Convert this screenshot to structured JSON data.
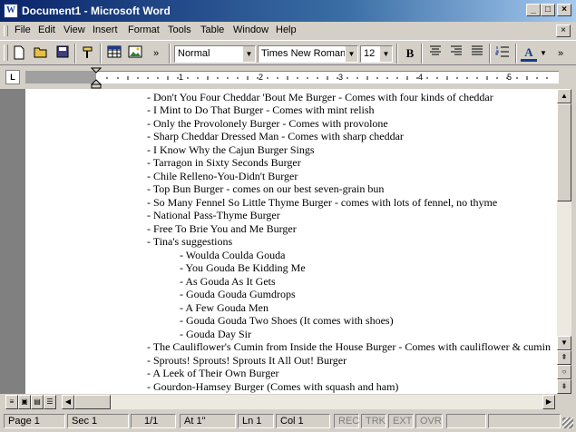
{
  "window": {
    "title": "Document1 - Microsoft Word",
    "app_icon": "W",
    "minimize": "_",
    "maximize": "□",
    "close": "×"
  },
  "menu": [
    "File",
    "Edit",
    "View",
    "Insert",
    "Format",
    "Tools",
    "Table",
    "Window",
    "Help"
  ],
  "mdi_close": "×",
  "toolbar": {
    "style_value": "Normal",
    "font_value": "Times New Roman",
    "size_value": "12",
    "bold_label": "B",
    "font_color_label": "A",
    "overflow_label": "»"
  },
  "ruler": {
    "numbers": [
      "1",
      "2",
      "3",
      "4",
      "5"
    ],
    "tab_marker": "L"
  },
  "document": {
    "lines": [
      "- Don't You Four Cheddar 'Bout Me Burger - Comes with four kinds of cheddar",
      "- I Mint to Do That Burger - Comes with mint relish",
      "- Only the Provolonely Burger - Comes with provolone",
      "- Sharp Cheddar Dressed Man - Comes with sharp cheddar",
      "- I Know Why the Cajun Burger Sings",
      "- Tarragon in Sixty Seconds Burger",
      "- Chile Relleno-You-Didn't Burger",
      "- Top Bun Burger - comes on our best seven-grain bun",
      "- So Many Fennel So Little Thyme Burger - comes with lots of fennel, no thyme",
      "- National Pass-Thyme Burger",
      "- Free To Brie You and Me Burger",
      "- Tina's suggestions"
    ],
    "sub_lines": [
      "- Woulda Coulda Gouda",
      "- You Gouda Be Kidding Me",
      "- As Gouda As It Gets",
      "- Gouda Gouda Gumdrops",
      "- A Few Gouda Men",
      "- Gouda Gouda Two Shoes (It comes with shoes)",
      "- Gouda Day Sir"
    ],
    "after_lines": [
      "- The Cauliflower's Cumin from Inside the House Burger - Comes with cauliflower & cumin",
      "- Sprouts! Sprouts! Sprouts It All Out! Burger",
      "- A Leek of Their Own Burger",
      "- Gourdon-Hamsey Burger (Comes with squash and ham)"
    ]
  },
  "status": {
    "page": "Page  1",
    "sec": "Sec  1",
    "pages": "1/1",
    "at": "At  1\"",
    "ln": "Ln  1",
    "col": "Col  1",
    "rec": "REC",
    "trk": "TRK",
    "ext": "EXT",
    "ovr": "OVR"
  }
}
